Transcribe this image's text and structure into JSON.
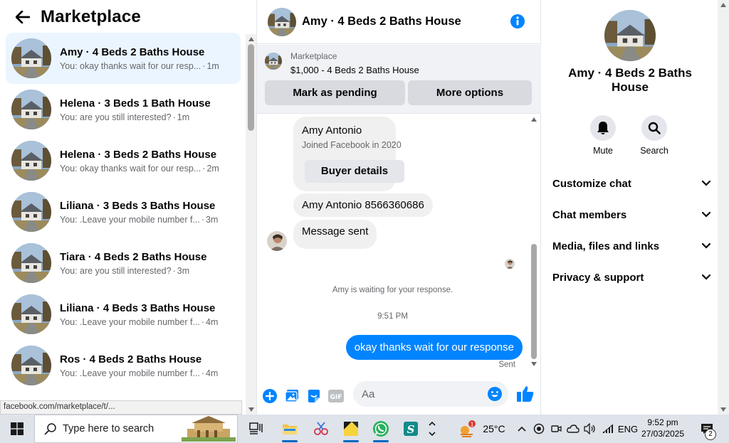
{
  "left": {
    "title": "Marketplace",
    "conversations": [
      {
        "name": "Amy · 4 Beds 2 Baths House",
        "snippet": "You: okay thanks wait for our resp...",
        "time": "1m",
        "active": true
      },
      {
        "name": "Helena · 3 Beds 1 Bath House",
        "snippet": "You: are you still interested?",
        "time": "1m"
      },
      {
        "name": "Helena · 3 Beds 2 Baths House",
        "snippet": "You: okay thanks wait for our resp...",
        "time": "2m"
      },
      {
        "name": "Liliana · 3 Beds 3 Baths House",
        "snippet": "You: .Leave your mobile number f...",
        "time": "3m"
      },
      {
        "name": "Tiara · 4 Beds 2 Baths House",
        "snippet": "You: are you still interested?",
        "time": "3m"
      },
      {
        "name": "Liliana · 4 Beds 3 Baths House",
        "snippet": "You: .Leave your mobile number f...",
        "time": "4m"
      },
      {
        "name": "Ros · 4 Beds 2 Baths House",
        "snippet": "You: .Leave your mobile number f...",
        "time": "4m"
      }
    ],
    "status_url": "facebook.com/marketplace/t/..."
  },
  "chat": {
    "title": "Amy · 4 Beds 2 Baths House",
    "marketplace_label": "Marketplace",
    "listing": "$1,000 - 4 Beds 2 Baths House",
    "mark_pending": "Mark as pending",
    "more_options": "More options",
    "buyer_name": "Amy Antonio",
    "buyer_joined": "Joined Facebook in 2020",
    "buyer_details": "Buyer details",
    "msg_phone": "Amy Antonio 8566360686",
    "msg_sent": "Message sent",
    "waiting": "Amy is waiting for your response.",
    "time": "9:51 PM",
    "outgoing": "okay thanks wait for our response",
    "sent_label": "Sent",
    "input_placeholder": "Aa"
  },
  "right": {
    "title": "Amy · 4 Beds 2 Baths House",
    "mute": "Mute",
    "search": "Search",
    "sections": [
      "Customize chat",
      "Chat members",
      "Media, files and links",
      "Privacy & support"
    ]
  },
  "taskbar": {
    "search_placeholder": "Type here to search",
    "temperature": "25°C",
    "language": "ENG",
    "time": "9:52 pm",
    "date": "27/03/2025",
    "weather_badge": "1",
    "notifications": "2"
  },
  "colors": {
    "accent": "#0084ff",
    "active_bg": "#ebf5ff",
    "bubble_in": "#f0f0f0"
  }
}
